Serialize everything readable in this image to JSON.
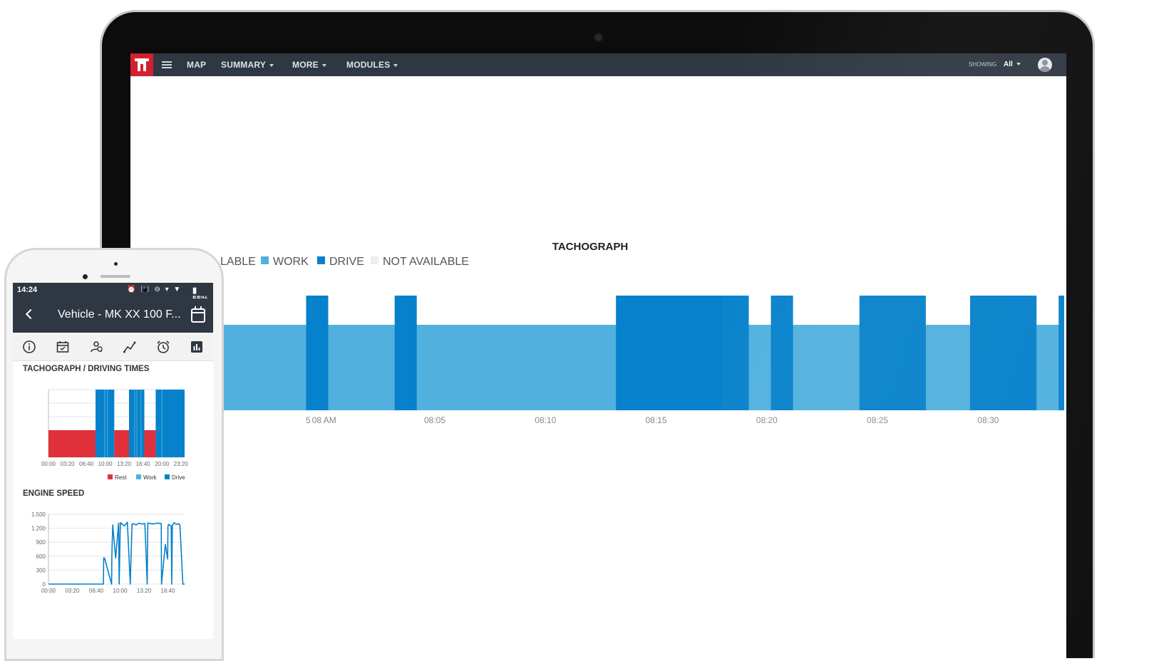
{
  "colors": {
    "nav_bg": "#2f3742",
    "brand_red": "#d31f2f",
    "work": "#51b0de",
    "drive": "#0681cb",
    "not_available": "#eeeeee",
    "rest": "#e0303a"
  },
  "desktop": {
    "logo_icon": "tt-logo-icon",
    "nav": {
      "menu_icon": "hamburger-icon",
      "items": [
        {
          "label": "MAP",
          "dropdown": false
        },
        {
          "label": "SUMMARY",
          "dropdown": true
        },
        {
          "label": "MORE",
          "dropdown": true
        },
        {
          "label": "MODULES",
          "dropdown": true
        }
      ],
      "showing_label": "SHOWING",
      "showing_value": "All",
      "avatar_icon": "user-avatar-icon"
    },
    "tachograph": {
      "title": "TACHOGRAPH",
      "legend": [
        {
          "label": "LABLE",
          "color": "#ffffff",
          "clipped": true
        },
        {
          "label": "WORK",
          "color": "#51b0de"
        },
        {
          "label": "DRIVE",
          "color": "#0681cb"
        },
        {
          "label": "NOT AVAILABLE",
          "color": "#eeeeee"
        }
      ]
    }
  },
  "phone": {
    "status": {
      "time": "14:24",
      "icons": "⏰ 📳 ⊖ ▾ ▼",
      "battery": "▮ 55%"
    },
    "title": "Vehicle - MK XX 100 F...",
    "tab_icons": [
      "info-icon",
      "calendar-icon",
      "driver-icon",
      "route-icon",
      "alarm-clock-icon",
      "bar-chart-icon"
    ],
    "section_1": "TACHOGRAPH / DRIVING TIMES",
    "section_2": "ENGINE SPEED",
    "legend": [
      {
        "label": "Rest",
        "color": "#e0303a"
      },
      {
        "label": "Work",
        "color": "#51b0de"
      },
      {
        "label": "Drive",
        "color": "#0681cb"
      }
    ]
  },
  "chart_data": [
    {
      "type": "area",
      "title": "TACHOGRAPH",
      "x_tick_labels": [
        "5",
        "08 AM",
        "08:05",
        "08:10",
        "08:15",
        "08:20",
        "08:25",
        "08:30"
      ],
      "x_ticks_min": [
        -0.83,
        0,
        5,
        10,
        15,
        20,
        25,
        30
      ],
      "x_range_min": [
        -4.5,
        33.5
      ],
      "levels": {
        "work": 1,
        "drive": 2
      },
      "baseline": {
        "state": "work",
        "from": -4.5,
        "to": 33.5
      },
      "drive_intervals": [
        [
          -0.75,
          0.25
        ],
        [
          3.25,
          4.25
        ],
        [
          13.25,
          19.25
        ],
        [
          20.25,
          21.25
        ],
        [
          24.25,
          27.25
        ],
        [
          29.25,
          32.25
        ],
        [
          33.25,
          33.5
        ]
      ]
    },
    {
      "type": "bar",
      "title": "TACHOGRAPH / DRIVING TIMES",
      "x_tick_labels": [
        "00:00",
        "03:20",
        "06:40",
        "10:00",
        "13:20",
        "16:40",
        "20:00",
        "23:20"
      ],
      "x_range_hours": [
        0,
        24
      ],
      "y_levels": {
        "Rest": 1,
        "Work": 2,
        "Drive": 3
      },
      "segments": [
        {
          "state": "Rest",
          "from": 0,
          "to": 8.3
        },
        {
          "state": "Drive",
          "from": 8.3,
          "to": 11.6
        },
        {
          "state": "Rest",
          "from": 11.6,
          "to": 14.2
        },
        {
          "state": "Drive",
          "from": 14.2,
          "to": 16.9
        },
        {
          "state": "Rest",
          "from": 16.9,
          "to": 18.9
        },
        {
          "state": "Drive",
          "from": 18.9,
          "to": 24
        }
      ]
    },
    {
      "type": "line",
      "title": "ENGINE SPEED",
      "x_tick_labels": [
        "00:00",
        "03:20",
        "06:40",
        "10:00",
        "13:20",
        "16:40"
      ],
      "x_range_hours": [
        0,
        23.3
      ],
      "y_tick_labels": [
        "1.500",
        "1.200",
        "900",
        "600",
        "300",
        "0"
      ],
      "ylim": [
        0,
        1500
      ],
      "series": [
        {
          "x": [
            0,
            9.4,
            9.45,
            9.6,
            10.8,
            10.85,
            11.0,
            11.5,
            12.0,
            12.1,
            12.3,
            13.0,
            13.5,
            14.0,
            14.3,
            14.35,
            14.5,
            15.0,
            15.5,
            16.0,
            16.5,
            16.9,
            17.0,
            17.5,
            18.0,
            18.5,
            19.3,
            19.35,
            20.0,
            20.4,
            20.45,
            20.55,
            21.0,
            21.1,
            21.2,
            21.5,
            21.8,
            22.0,
            22.3,
            22.5,
            23.0,
            23.3
          ],
          "y": [
            0,
            0,
            560,
            560,
            0,
            620,
            1270,
            560,
            1310,
            0,
            1320,
            1250,
            1330,
            0,
            1290,
            1280,
            1300,
            1270,
            1310,
            1290,
            1300,
            0,
            1310,
            1300,
            1290,
            1310,
            1300,
            0,
            850,
            540,
            1240,
            1280,
            1250,
            0,
            1260,
            1320,
            1290,
            1280,
            1300,
            1260,
            0,
            0
          ]
        }
      ]
    }
  ]
}
